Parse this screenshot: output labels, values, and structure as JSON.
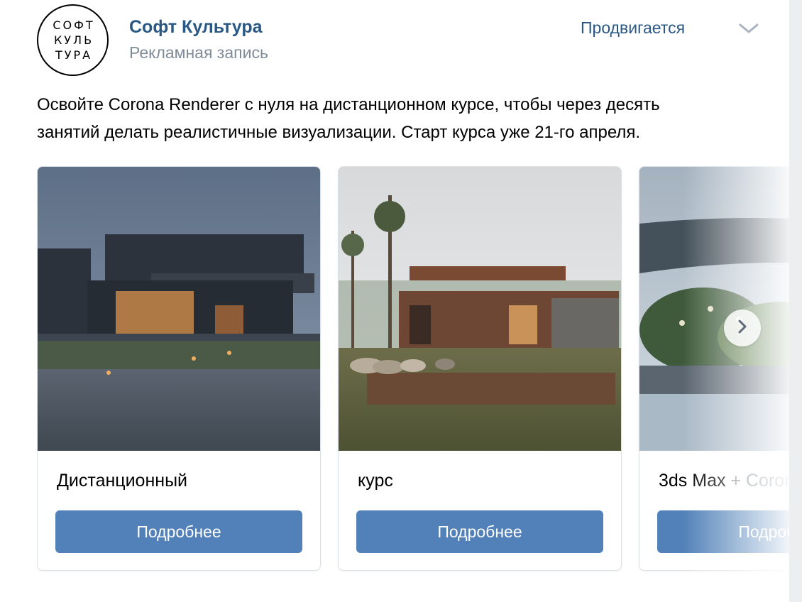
{
  "author": {
    "logo_lines": [
      "СОФТ",
      "КУЛЬ",
      "ТУРА"
    ],
    "name": "Софт Культура",
    "subtitle": "Рекламная запись"
  },
  "header": {
    "promoted": "Продвигается"
  },
  "post": {
    "text_line1": "Освойте Corona Renderer с нуля на дистанционном курсе, чтобы через десять",
    "text_line2": "занятий делать реалистичные визуализации. Старт курса уже 21-го апреля."
  },
  "carousel": {
    "cards": [
      {
        "title": "Дистанционный",
        "button": "Подробнее"
      },
      {
        "title": "курс",
        "button": "Подробнее"
      },
      {
        "title_a": "3ds Max",
        "title_plus": "+",
        "title_b": "Corona",
        "button": "Подробнее"
      }
    ]
  },
  "icons": {
    "expand": "chevron-down-icon",
    "next": "chevron-right-icon"
  },
  "colors": {
    "link": "#2a5885",
    "button": "#5181b8",
    "secondary_text": "#818c99"
  }
}
